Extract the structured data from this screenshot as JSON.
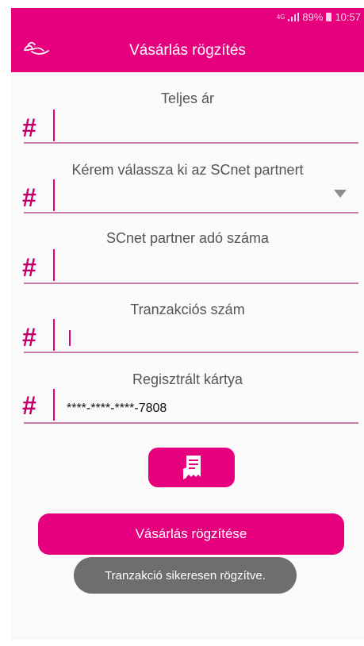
{
  "status_bar": {
    "network": "4G",
    "battery": "89%",
    "time": "10:57"
  },
  "toolbar": {
    "title": "Vásárlás rögzítés"
  },
  "form": {
    "total_price": {
      "label": "Teljes ár",
      "value": ""
    },
    "partner": {
      "label": "Kérem válassza ki az SCnet partnert",
      "value": ""
    },
    "tax_number": {
      "label": "SCnet partner adó száma",
      "value": ""
    },
    "transaction_number": {
      "label": "Tranzakciós szám",
      "value": ""
    },
    "card": {
      "label": "Regisztrált kártya",
      "value": "****-****-****-7808"
    },
    "field_prefix": "#"
  },
  "submit_label": "Vásárlás rögzítése",
  "toast": "Tranzakció sikeresen rögzítve.",
  "icons": {
    "logo": "leaf-logo-icon",
    "receipt": "receipt-icon"
  },
  "colors": {
    "primary": "#e6007e",
    "hash": "#c2006b",
    "toast_bg": "#6e6e6e"
  }
}
